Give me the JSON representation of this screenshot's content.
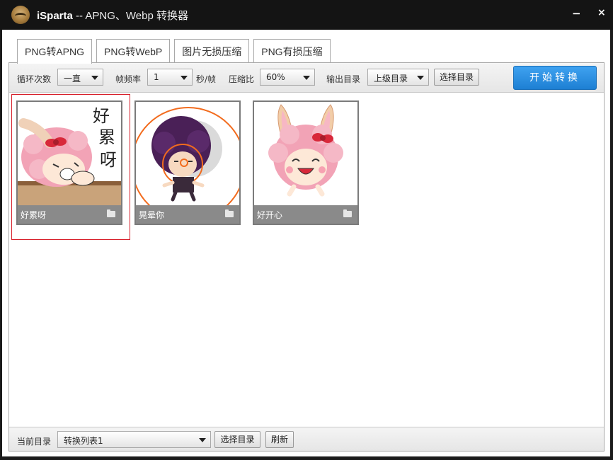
{
  "window": {
    "brand": "iSparta",
    "title_rest": " -- APNG、Webp 转换器",
    "min_label": "−",
    "close_label": "×"
  },
  "tabs": [
    {
      "label": "PNG转APNG",
      "active": true
    },
    {
      "label": "PNG转WebP",
      "active": false
    },
    {
      "label": "图片无损压缩",
      "active": false
    },
    {
      "label": "PNG有损压缩",
      "active": false
    }
  ],
  "toolbar": {
    "loop_label": "循环次数",
    "loop_value": "一直",
    "fps_label": "帧频率",
    "fps_value": "1",
    "fps_unit": "秒/帧",
    "ratio_label": "压缩比",
    "ratio_value": "60%",
    "output_label": "输出目录",
    "output_value": "上级目录",
    "choose_dir": "选择目录",
    "start": "开始转换"
  },
  "items": [
    {
      "name": "好累呀",
      "text_art": "好累呀"
    },
    {
      "name": "晃晕你"
    },
    {
      "name": "好开心"
    }
  ],
  "status": {
    "current_dir_label": "当前目录",
    "current_dir_value": "转换列表1",
    "choose_dir": "选择目录",
    "refresh": "刷新"
  },
  "colors": {
    "accent": "#1d7fd3",
    "selection": "#d71f2a",
    "caption_bg": "#8a8a8a"
  }
}
